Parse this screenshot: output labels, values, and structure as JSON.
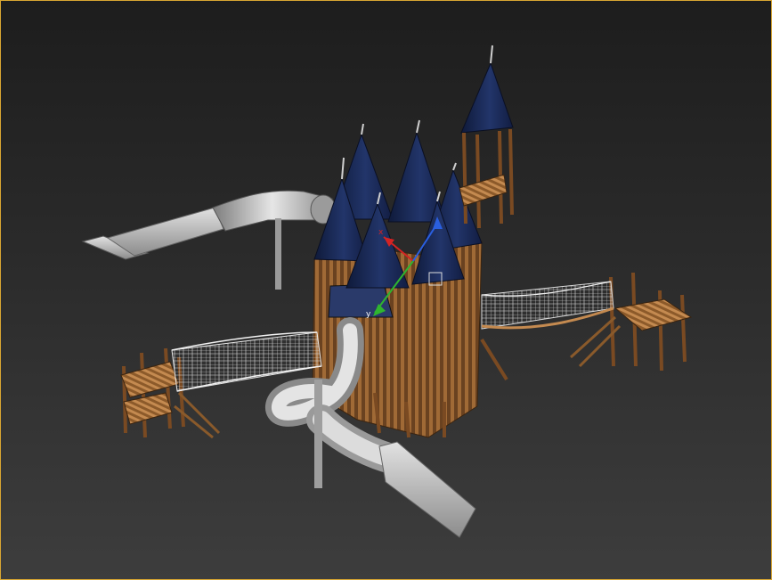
{
  "viewport": {
    "border_color": "#d9a632",
    "background_top": "#1d1d1d",
    "background_bottom": "#3d3d3d"
  },
  "gizmo": {
    "x_label": "x",
    "y_label": "y",
    "z_label": "",
    "x_color": "#d42323",
    "y_color": "#2fb52f",
    "z_color": "#2a5fe0"
  },
  "model": {
    "roof_color": "#1a2a55",
    "wood_color": "#8a5a2b",
    "slide_color": "#b8b8b8",
    "net_color": "#e8e8e8"
  }
}
